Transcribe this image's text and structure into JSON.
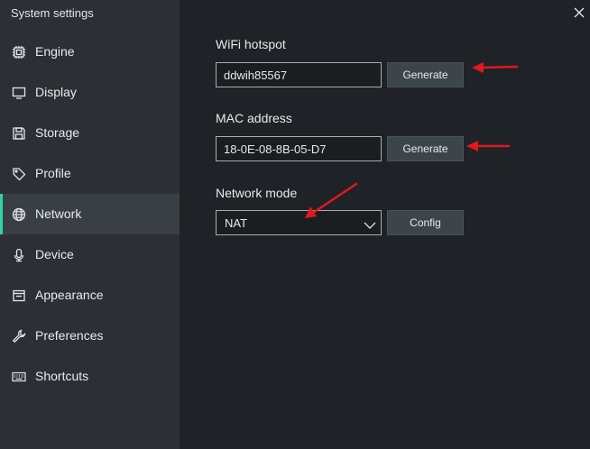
{
  "window": {
    "title": "System settings",
    "close_icon": "close-icon"
  },
  "sidebar": {
    "active": "Network",
    "accent_color": "#2fd6a0",
    "items": [
      {
        "label": "Engine",
        "icon": "chip-icon"
      },
      {
        "label": "Display",
        "icon": "monitor-icon"
      },
      {
        "label": "Storage",
        "icon": "floppy-disk-icon"
      },
      {
        "label": "Profile",
        "icon": "tag-icon"
      },
      {
        "label": "Network",
        "icon": "globe-icon"
      },
      {
        "label": "Device",
        "icon": "microphone-icon"
      },
      {
        "label": "Appearance",
        "icon": "window-icon"
      },
      {
        "label": "Preferences",
        "icon": "wrench-icon"
      },
      {
        "label": "Shortcuts",
        "icon": "keyboard-icon"
      }
    ]
  },
  "network": {
    "wifi": {
      "label": "WiFi hotspot",
      "value": "ddwih85567",
      "button": "Generate"
    },
    "mac": {
      "label": "MAC address",
      "value": "18-0E-08-8B-05-D7",
      "button": "Generate"
    },
    "mode": {
      "label": "Network mode",
      "selected": "NAT",
      "button": "Config"
    }
  },
  "annotations": {
    "arrow_color": "#e0191f",
    "arrows": [
      "red-arrow-wifi-generate",
      "red-arrow-mac-generate",
      "red-arrow-network-mode"
    ]
  }
}
